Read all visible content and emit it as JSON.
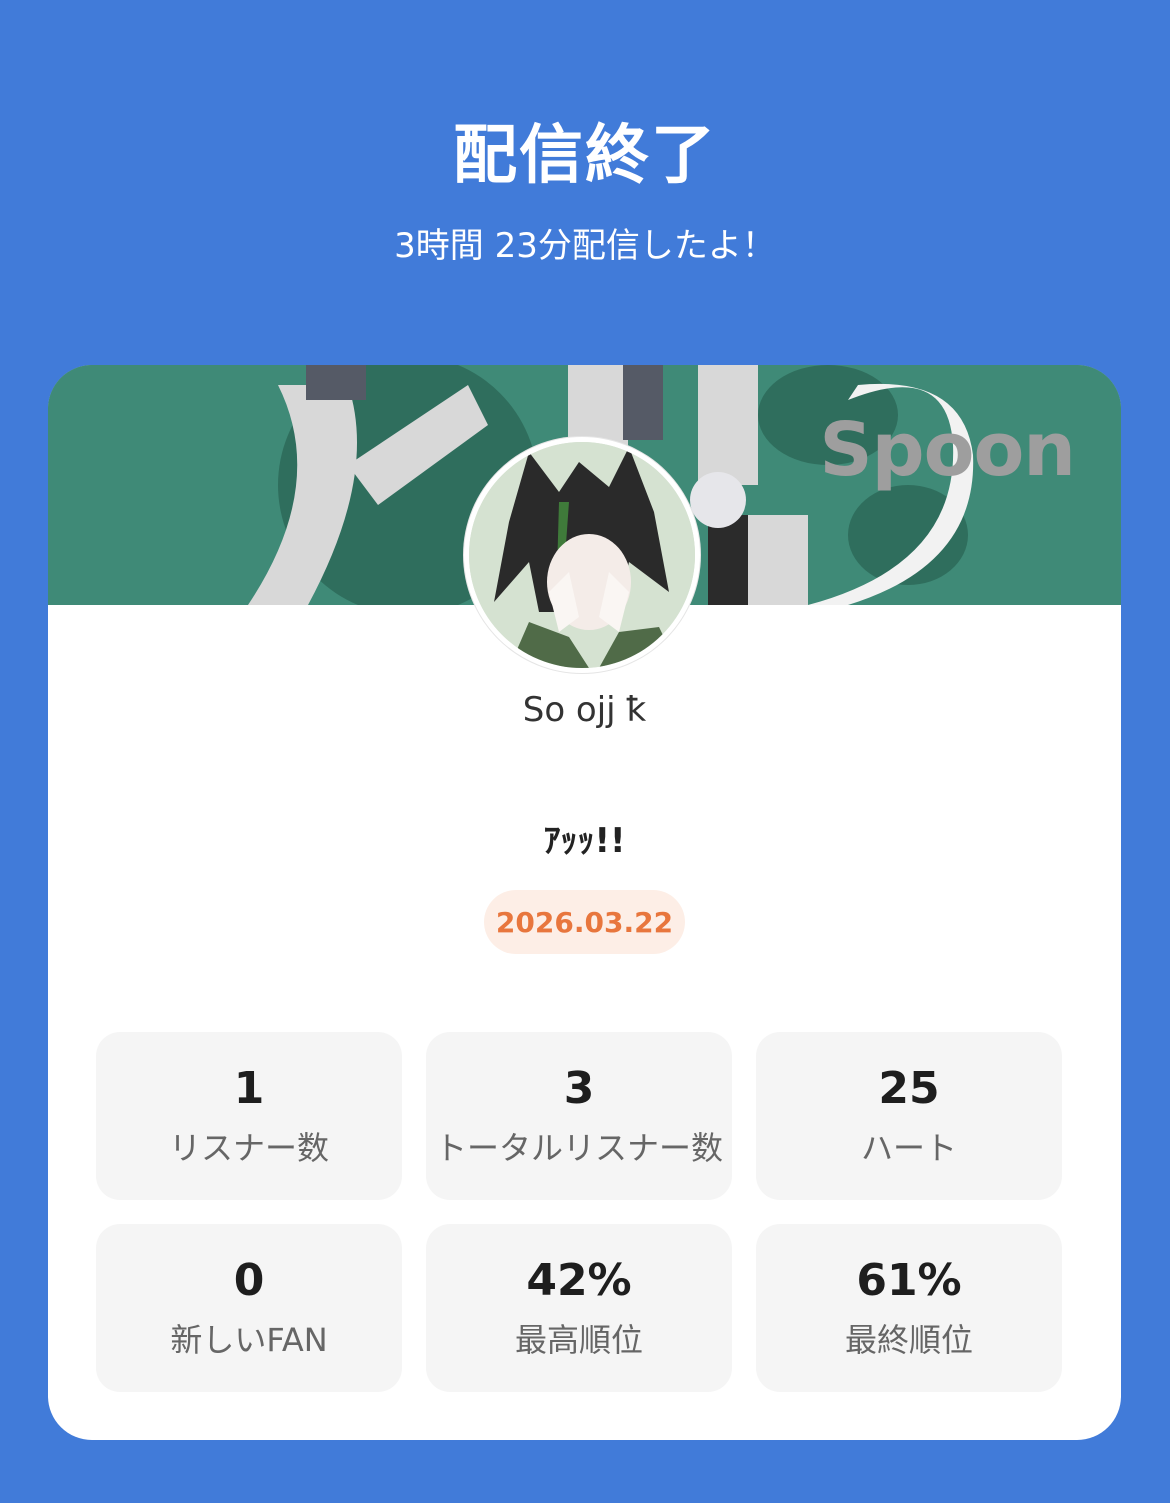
{
  "header": {
    "title": "配信終了",
    "subtitle": "3時間 23分配信したよ！"
  },
  "banner": {
    "brand_logo": "Spoon",
    "background_color": "#3f8a77"
  },
  "profile": {
    "avatar_icon": "user-avatar",
    "username": "So ojj ꝁ"
  },
  "live": {
    "title": "ｱｯｯ!!",
    "date": "2026.03.22"
  },
  "stats": [
    {
      "value": "1",
      "label": "リスナー数"
    },
    {
      "value": "3",
      "label": "トータルリスナー数"
    },
    {
      "value": "25",
      "label": "ハート"
    },
    {
      "value": "0",
      "label": "新しいFAN"
    },
    {
      "value": "42%",
      "label": "最高順位"
    },
    {
      "value": "61%",
      "label": "最終順位"
    }
  ],
  "colors": {
    "page_background": "#417bd9",
    "date_badge_text": "#e8763d",
    "date_badge_background": "#fdeee6"
  }
}
